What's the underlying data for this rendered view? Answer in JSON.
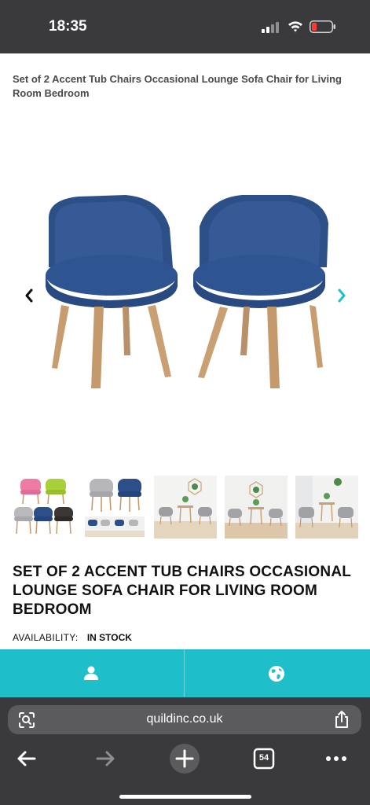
{
  "status": {
    "time": "18:35"
  },
  "page_title": "Set of 2 Accent Tub Chairs Occasional Lounge Sofa Chair for Living Room Bedroom",
  "product": {
    "title": "SET OF 2 ACCENT TUB CHAIRS OCCASIONAL LOUNGE SOFA CHAIR FOR LIVING ROOM BEDROOM",
    "availability_label": "AVAILABILITY:",
    "availability_value": "IN STOCK"
  },
  "colors": {
    "accent": "#1fbfc9",
    "chair_blue": "#2e4f86",
    "wood": "#c49a6c",
    "browser_bg": "#3a3a3c"
  },
  "browser": {
    "url": "quildinc.co.uk",
    "tab_count": "54"
  }
}
